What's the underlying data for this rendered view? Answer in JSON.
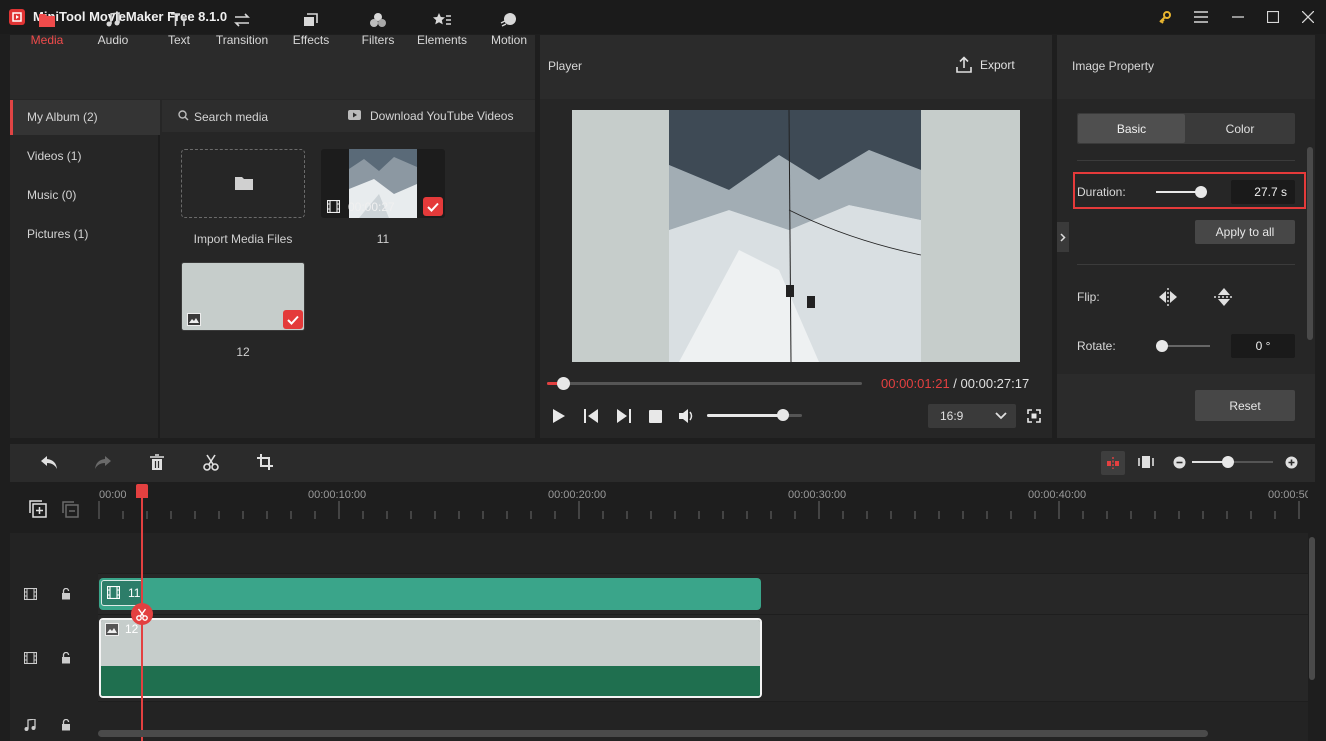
{
  "app": {
    "title": "MiniTool MovieMaker Free 8.1.0"
  },
  "media_tabs": [
    {
      "label": "Media",
      "icon": "folder-icon",
      "active": true
    },
    {
      "label": "Audio",
      "icon": "music-note-icon"
    },
    {
      "label": "Text",
      "icon": "text-icon"
    },
    {
      "label": "Transition",
      "icon": "transition-icon"
    },
    {
      "label": "Effects",
      "icon": "effects-icon"
    },
    {
      "label": "Filters",
      "icon": "filters-icon"
    },
    {
      "label": "Elements",
      "icon": "elements-icon"
    },
    {
      "label": "Motion",
      "icon": "motion-icon"
    }
  ],
  "album": {
    "items": [
      {
        "label": "My Album (2)",
        "active": true
      },
      {
        "label": "Videos (1)"
      },
      {
        "label": "Music (0)"
      },
      {
        "label": "Pictures (1)"
      }
    ]
  },
  "media_search": {
    "label": "Search media",
    "download_label": "Download YouTube Videos"
  },
  "media_items": {
    "import_label": "Import Media Files",
    "items": [
      {
        "name": "11",
        "type": "video",
        "duration": "00:00:27",
        "selected": true
      },
      {
        "name": "12",
        "type": "image",
        "selected": true
      }
    ]
  },
  "player": {
    "title": "Player",
    "export_label": "Export",
    "current_time": "00:00:01:21",
    "separator": " / ",
    "total_time": "00:00:27:17",
    "progress": 0.05,
    "volume": 0.8,
    "aspect_ratio": "16:9"
  },
  "property": {
    "title": "Image Property",
    "tabs": [
      "Basic",
      "Color"
    ],
    "active_tab": "Basic",
    "duration_label": "Duration:",
    "duration_value": "27.7 s",
    "duration_slider": 0.9,
    "apply_all_label": "Apply to all",
    "flip_label": "Flip:",
    "rotate_label": "Rotate:",
    "rotate_value": "0 °",
    "reset_label": "Reset"
  },
  "timeline": {
    "ticks": [
      "00:00",
      "00:00:10:00",
      "00:00:20:00",
      "00:00:30:00",
      "00:00:40:00",
      "00:00:50"
    ],
    "clips": [
      {
        "name": "11",
        "type": "video"
      },
      {
        "name": "12",
        "type": "image"
      }
    ],
    "zoom": 0.45
  },
  "colors": {
    "accent": "#e34040",
    "video_clip": "#3aa58a",
    "image_clip_bottom": "#1f6f4f",
    "panel": "#262626"
  }
}
